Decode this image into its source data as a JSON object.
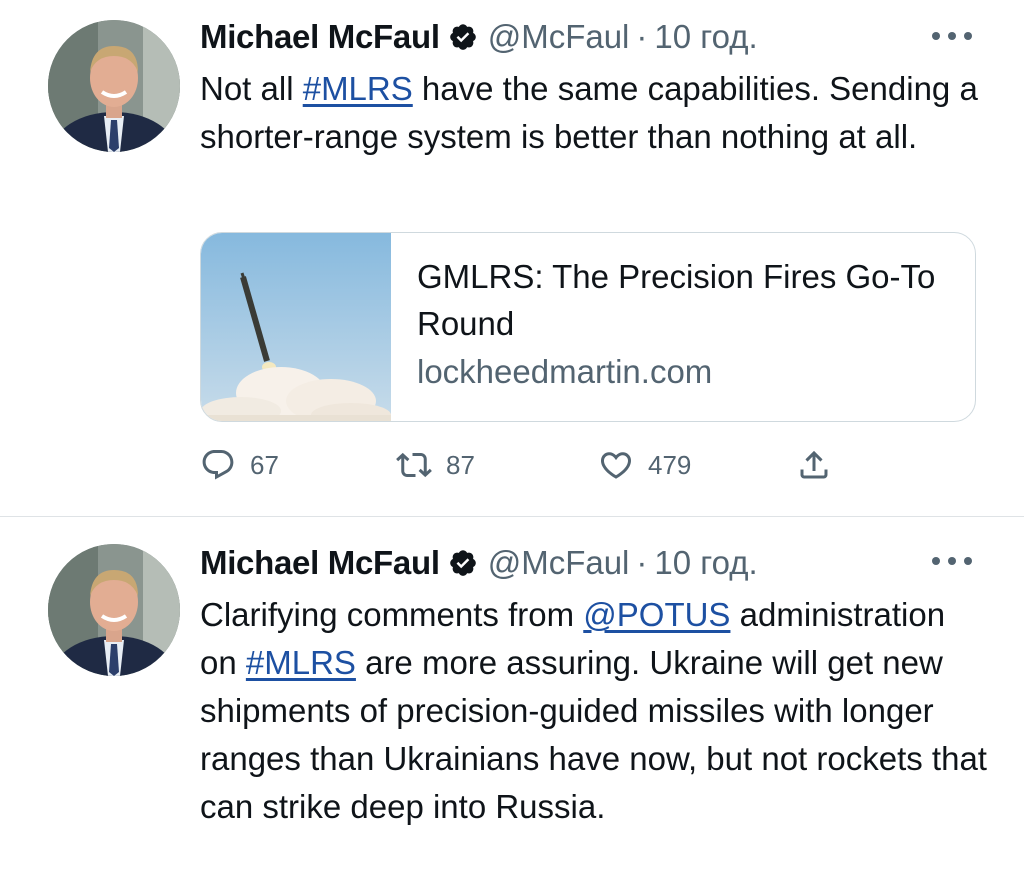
{
  "colors": {
    "text": "#0f1419",
    "secondary": "#536471",
    "link": "#1d50a2",
    "verified": "#0f1419",
    "border": "#cfd9de"
  },
  "tweets": [
    {
      "author_name": "Michael McFaul",
      "handle": "@McFaul",
      "separator": "·",
      "time": "10 год.",
      "text_parts": [
        {
          "text": "Not all ",
          "link": false
        },
        {
          "text": "#MLRS",
          "link": true
        },
        {
          "text": " have the same capabilities. Sending a shorter-range system is better than nothing at all.",
          "link": false
        }
      ],
      "card": {
        "title": "GMLRS: The Precision Fires Go-To Round",
        "domain": "lockheedmartin.com",
        "image_icon": "rocket-launch-image"
      },
      "actions": {
        "reply": {
          "icon": "reply-icon",
          "count": "67"
        },
        "retweet": {
          "icon": "retweet-icon",
          "count": "87"
        },
        "like": {
          "icon": "heart-icon",
          "count": "479"
        },
        "share": {
          "icon": "share-icon"
        }
      }
    },
    {
      "author_name": "Michael McFaul",
      "handle": "@McFaul",
      "separator": "·",
      "time": "10 год.",
      "text_parts": [
        {
          "text": "Clarifying comments from ",
          "link": false
        },
        {
          "text": "@POTUS",
          "link": true
        },
        {
          "text": " administration on ",
          "link": false
        },
        {
          "text": "#MLRS",
          "link": true
        },
        {
          "text": " are more assuring. Ukraine will get new shipments of precision-guided missiles with longer ranges than Ukrainians have now, but not rockets that can strike deep into Russia.",
          "link": false
        }
      ]
    }
  ]
}
